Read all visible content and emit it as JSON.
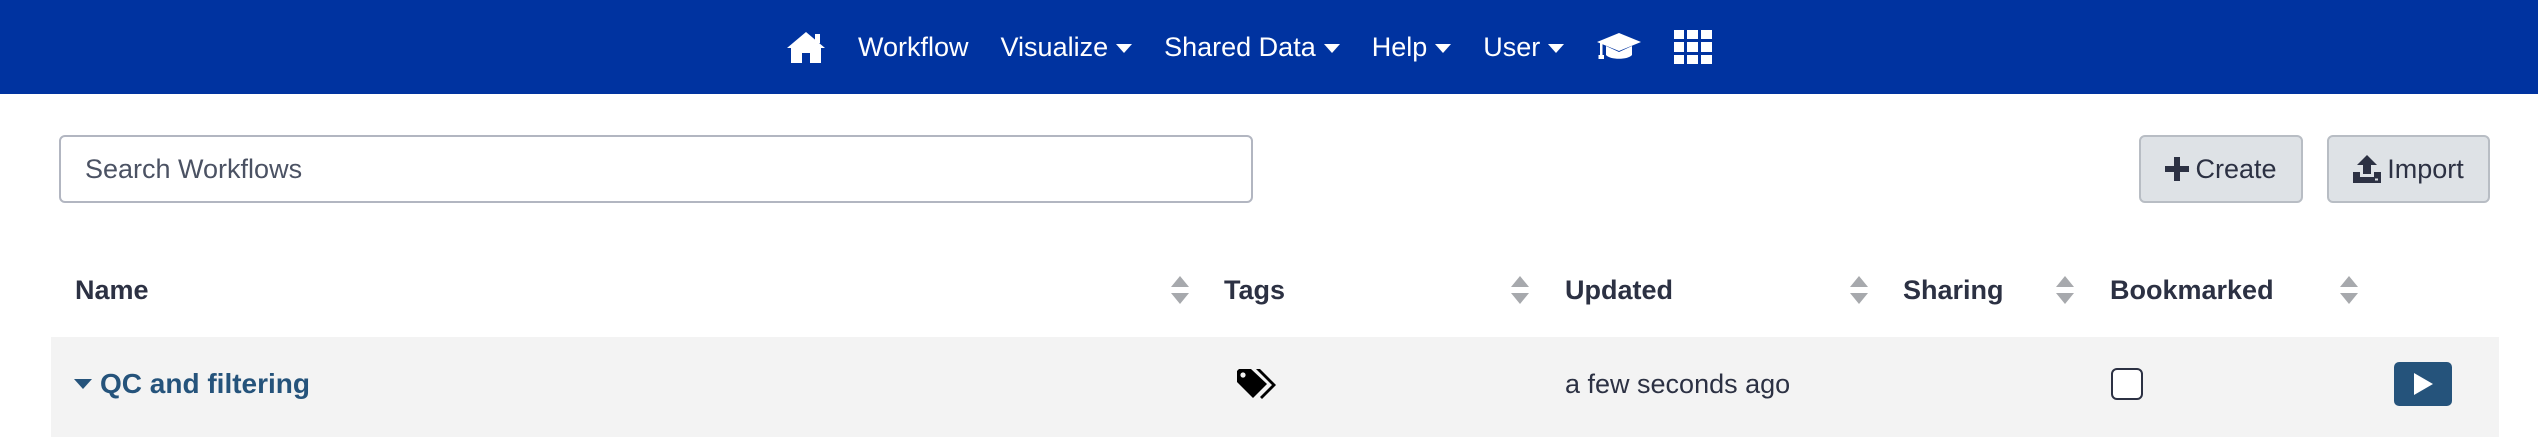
{
  "navbar": {
    "workflow": "Workflow",
    "visualize": "Visualize",
    "shared_data": "Shared Data",
    "help": "Help",
    "user": "User"
  },
  "search": {
    "placeholder": "Search Workflows"
  },
  "actions": {
    "create_label": "Create",
    "import_label": "Import"
  },
  "table": {
    "columns": [
      "Name",
      "Tags",
      "Updated",
      "Sharing",
      "Bookmarked"
    ],
    "rows": [
      {
        "name": "QC and filtering",
        "updated": "a few seconds ago",
        "bookmarked": false
      }
    ]
  },
  "colors": {
    "navbar_bg": "#0033a0",
    "link": "#25537b",
    "button_bg": "#dee2e6",
    "row_bg": "#f3f3f3"
  }
}
